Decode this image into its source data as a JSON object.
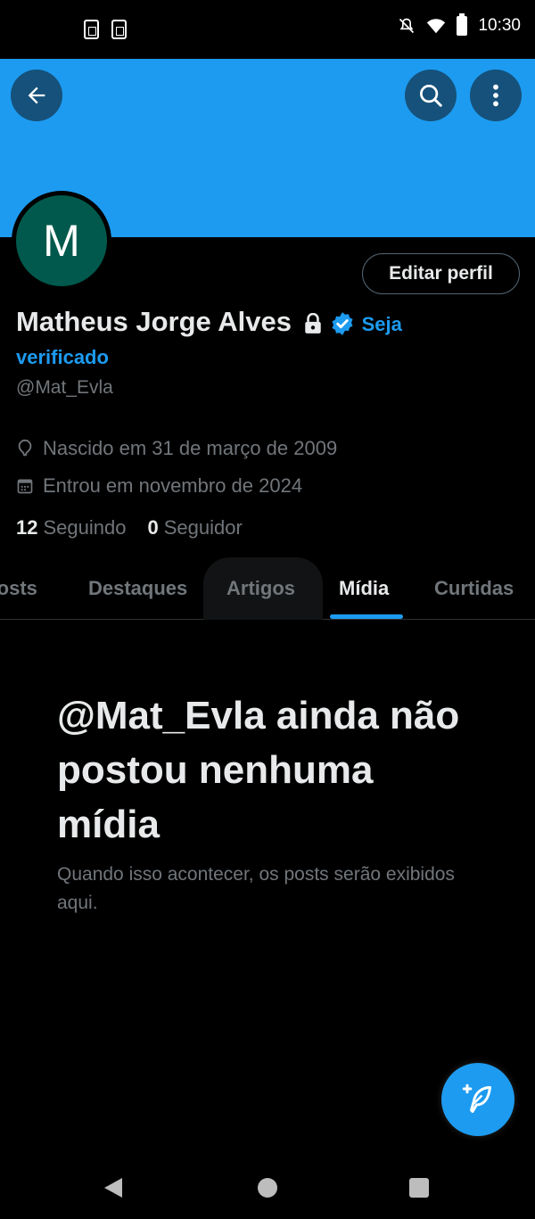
{
  "status_bar": {
    "time": "10:30"
  },
  "profile": {
    "avatar_letter": "M",
    "name": "Matheus Jorge Alves",
    "verify_cta": "Seja",
    "verify_cta2": "verificado",
    "handle": "@Mat_Evla",
    "born": "Nascido em 31 de março de 2009",
    "joined": "Entrou em novembro de 2024",
    "following_count": "12",
    "following_label": "Seguindo",
    "followers_count": "0",
    "followers_label": "Seguidor",
    "edit_button": "Editar perfil"
  },
  "tabs": [
    {
      "label": "Posts"
    },
    {
      "label": "Destaques"
    },
    {
      "label": "Artigos"
    },
    {
      "label": "Mídia"
    },
    {
      "label": "Curtidas"
    }
  ],
  "active_tab": "Mídia",
  "empty_state": {
    "title": "@Mat_Evla ainda não postou nenhuma mídia",
    "subtitle": "Quando isso acontecer, os posts serão exibidos aqui."
  },
  "icons": [
    "back-arrow-icon",
    "search-icon",
    "more-vertical-icon",
    "lock-icon",
    "verified-badge-icon",
    "location-pin-icon",
    "calendar-icon",
    "compose-icon"
  ],
  "colors": {
    "accent": "#1d9bf0",
    "avatar_bg": "#00594c"
  }
}
